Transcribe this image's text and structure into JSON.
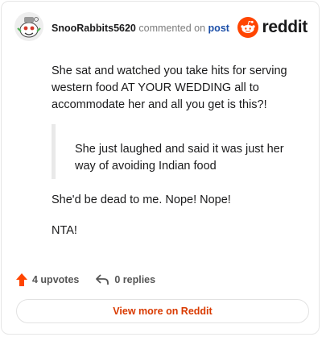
{
  "header": {
    "username": "SnooRabbits5620",
    "action": "commented on",
    "target": "post",
    "brand": "reddit"
  },
  "comment": {
    "paragraph_1": "She sat and watched you take hits for serving western food AT YOUR WEDDING all to accommodate her and all you get is this?!",
    "quote": "She just laughed and said it was just her way of avoiding Indian food",
    "paragraph_2": "She'd be dead to me. Nope! Nope!",
    "paragraph_3": "NTA!"
  },
  "footer": {
    "upvotes": "4 upvotes",
    "replies": "0 replies"
  },
  "view_more": "View more on Reddit",
  "colors": {
    "accent": "#ff4500",
    "link": "#1c4fa8",
    "view_more_text": "#d93a00"
  },
  "icons": {
    "avatar": "snoo-avatar-icon",
    "brand": "reddit-logo-icon",
    "upvote": "upvote-arrow-icon",
    "reply": "reply-arrow-icon"
  }
}
